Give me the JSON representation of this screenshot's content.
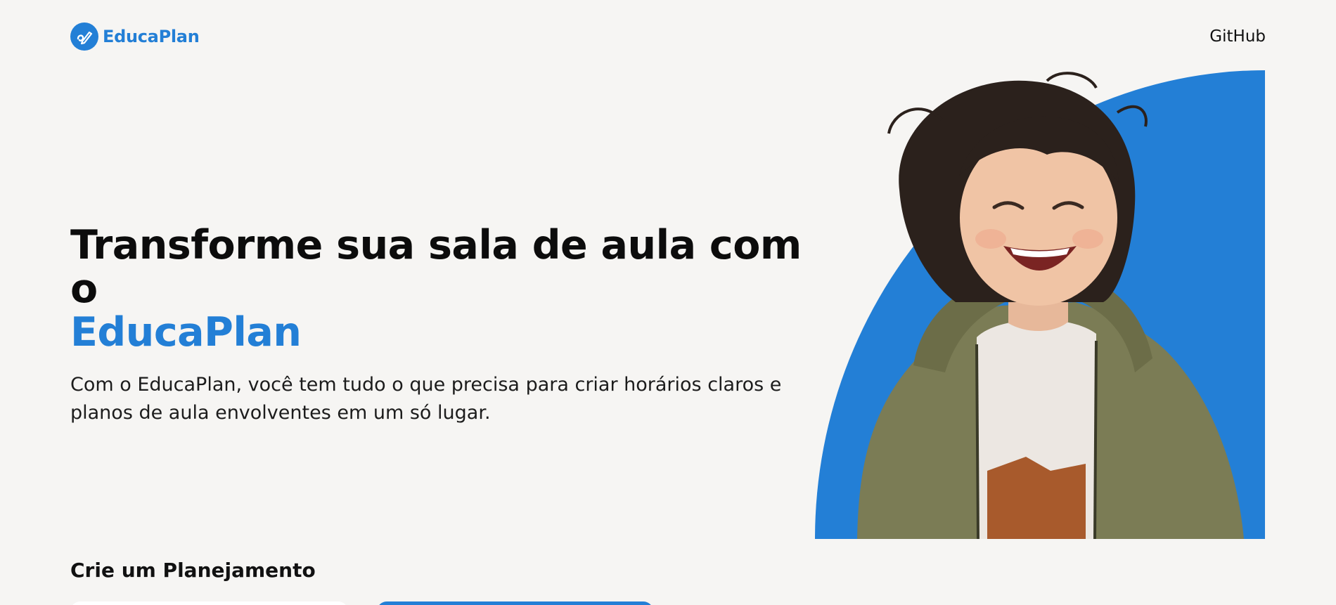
{
  "header": {
    "brand": {
      "name": "EducaPlan",
      "logo_icon": "pencil-link-icon"
    },
    "nav": {
      "github_label": "GitHub"
    }
  },
  "hero": {
    "title_line1": "Transforme sua sala de aula com o",
    "title_accent": "EducaPlan",
    "subtitle": "Com o EducaPlan, você tem tudo o que precisa para criar horários claros e planos de aula envolventes em um só lugar.",
    "image": {
      "icon": "smiling-child-photo",
      "backdrop": "blue-quarter-circle"
    }
  },
  "section": {
    "title": "Crie um Planejamento"
  },
  "colors": {
    "accent": "#237fd6",
    "background": "#f6f5f3",
    "text": "#111111",
    "jacket": "#7b7c55",
    "hair": "#2b211c"
  }
}
